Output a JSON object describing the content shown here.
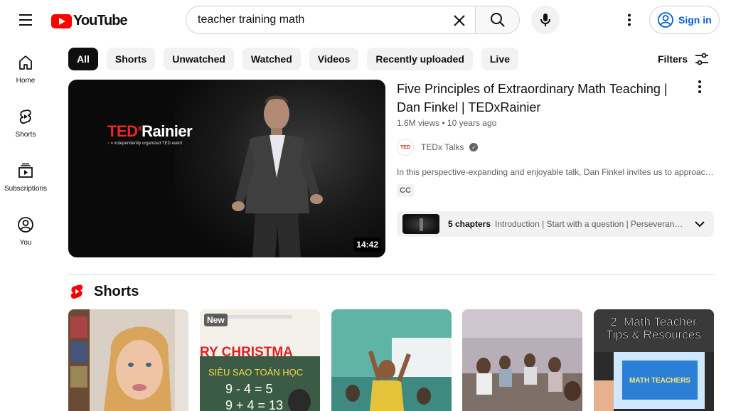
{
  "header": {
    "logo_text": "YouTube",
    "search_value": "teacher training math",
    "signin_label": "Sign in"
  },
  "sidebar": {
    "items": [
      {
        "label": "Home",
        "icon": "home-icon"
      },
      {
        "label": "Shorts",
        "icon": "shorts-icon"
      },
      {
        "label": "Subscriptions",
        "icon": "subscriptions-icon"
      },
      {
        "label": "You",
        "icon": "you-icon"
      }
    ]
  },
  "chips": [
    "All",
    "Shorts",
    "Unwatched",
    "Watched",
    "Videos",
    "Recently uploaded",
    "Live"
  ],
  "active_chip": "All",
  "filters_label": "Filters",
  "video": {
    "title": "Five Principles of Extraordinary Math Teaching | Dan Finkel | TEDxRainier",
    "views": "1.6M views",
    "age": "10 years ago",
    "channel": "TEDx Talks",
    "channel_avatar_text": "TED",
    "description": "In this perspective-expanding and enjoyable talk, Dan Finkel invites us to approach math with curiosity and a sense of play...",
    "badge": "CC",
    "duration": "14:42",
    "chapters_count": "5 chapters",
    "chapters_list": "Introduction | Start with a question | Perseverance | Make it fun | Give students time to struggle",
    "thumb_brand": "TED",
    "thumb_brand_sup": "x",
    "thumb_brand_suffix": "Rainier",
    "thumb_sub_x": "x",
    "thumb_sub": " = independently organized TED event"
  },
  "shorts": {
    "title": "Shorts",
    "items": [
      {
        "badge": ""
      },
      {
        "badge": "New",
        "caption": "RY CHRISTMA",
        "board_title": "SIÊU SAO TOÁN HỌC",
        "board_line1": "9 - 4 = 5",
        "board_line2": "9 + 4 = 13"
      },
      {
        "badge": ""
      },
      {
        "badge": ""
      },
      {
        "badge": "",
        "overlay_line1": "2. Math Teacher",
        "overlay_line2": "Tips & Resources",
        "screen_text": "MATH TEACHERS"
      }
    ]
  },
  "colors": {
    "brand_red": "#ff0000",
    "link_blue": "#065fd4",
    "ted_red": "#e62b1e"
  }
}
